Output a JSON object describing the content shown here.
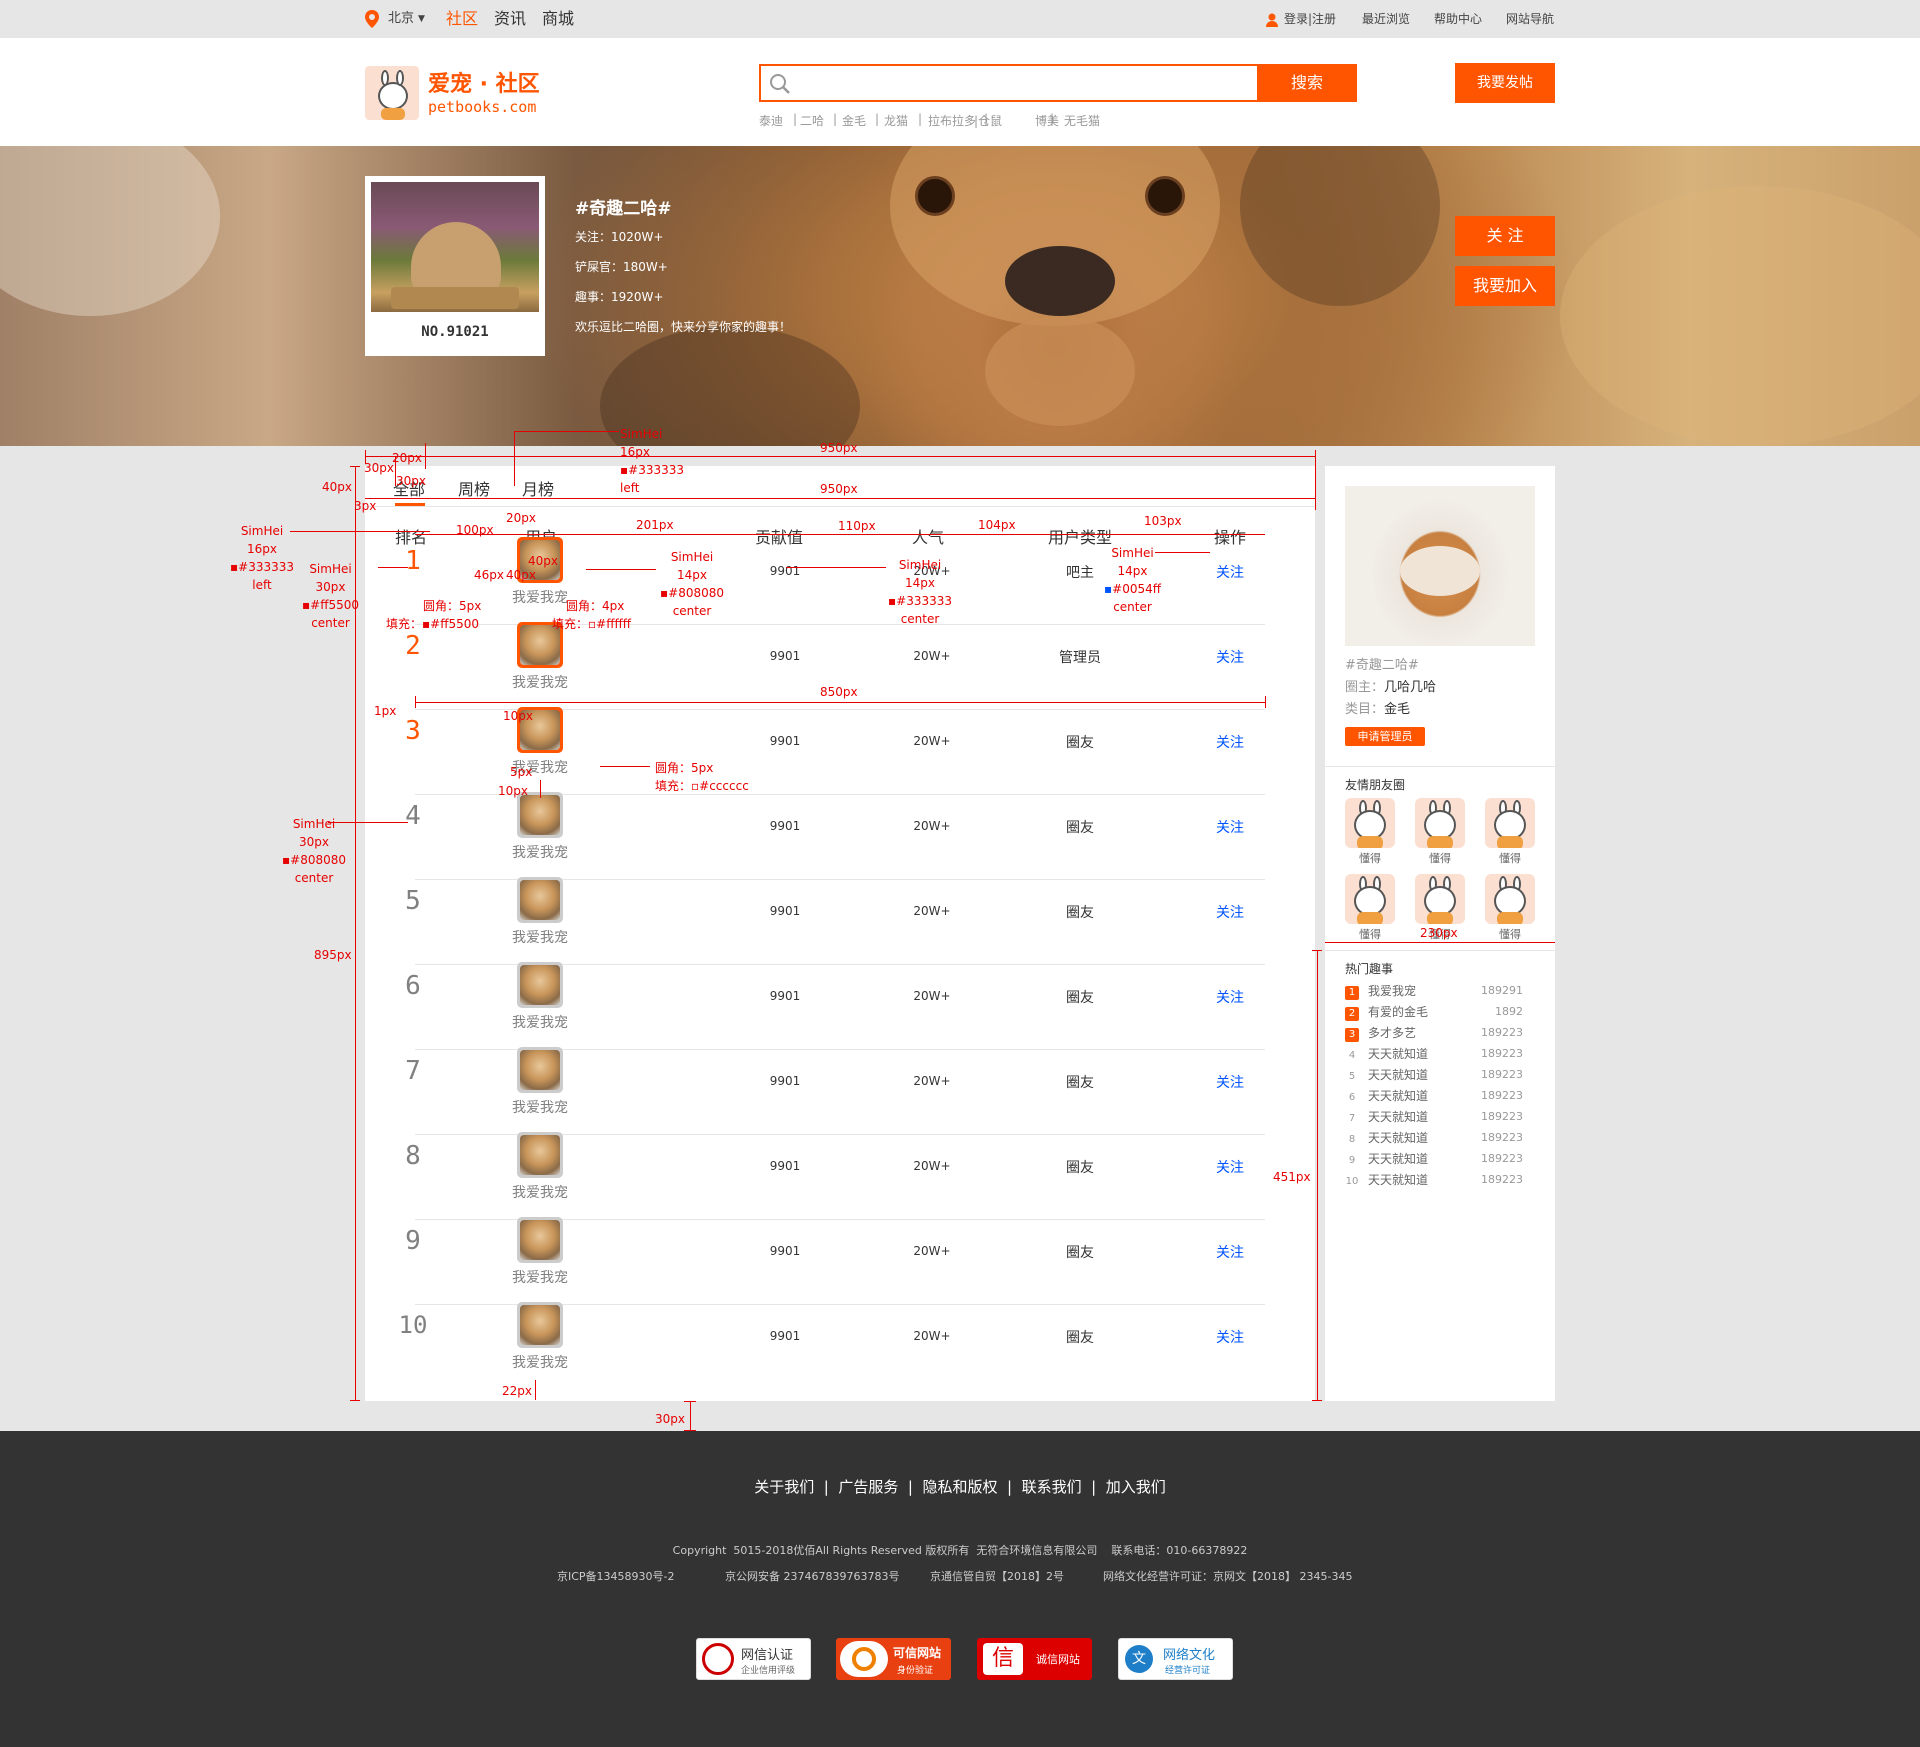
{
  "topbar": {
    "city": "北京",
    "nav": [
      "社区",
      "资讯",
      "商城"
    ],
    "login": "登录|注册",
    "right": [
      "最近浏览",
      "帮助中心",
      "网站导航"
    ]
  },
  "logo": {
    "title": "爱宠 · 社区",
    "domain": "petbooks.com"
  },
  "search": {
    "button": "搜索",
    "tags": [
      "泰迪",
      "|",
      "二哈",
      "|",
      "金毛",
      "|",
      "龙猫",
      "|",
      "拉布拉多",
      "|仓鼠",
      "|",
      "博美",
      "|",
      "无毛猫"
    ]
  },
  "post_button": "我要发帖",
  "banner": {
    "card_no": "NO.91021",
    "title": "#奇趣二哈#",
    "follow": "关注：1020W+",
    "officers": "铲屎官：180W+",
    "fun": "趣事：1920W+",
    "desc": "欢乐逗比二哈圈，快来分享你家的趣事！",
    "follow_btn": "关 注",
    "join_btn": "我要加入"
  },
  "tabs": [
    "全部",
    "周榜",
    "月榜"
  ],
  "table": {
    "headers": [
      "排名",
      "用户",
      "贡献值",
      "人气",
      "用户类型",
      "操作"
    ],
    "rows": [
      {
        "rank": "1",
        "user": "我爱我宠",
        "contrib": "9901",
        "pop": "20W+",
        "type": "吧主",
        "op": "关注"
      },
      {
        "rank": "2",
        "user": "我爱我宠",
        "contrib": "9901",
        "pop": "20W+",
        "type": "管理员",
        "op": "关注"
      },
      {
        "rank": "3",
        "user": "我爱我宠",
        "contrib": "9901",
        "pop": "20W+",
        "type": "圈友",
        "op": "关注"
      },
      {
        "rank": "4",
        "user": "我爱我宠",
        "contrib": "9901",
        "pop": "20W+",
        "type": "圈友",
        "op": "关注"
      },
      {
        "rank": "5",
        "user": "我爱我宠",
        "contrib": "9901",
        "pop": "20W+",
        "type": "圈友",
        "op": "关注"
      },
      {
        "rank": "6",
        "user": "我爱我宠",
        "contrib": "9901",
        "pop": "20W+",
        "type": "圈友",
        "op": "关注"
      },
      {
        "rank": "7",
        "user": "我爱我宠",
        "contrib": "9901",
        "pop": "20W+",
        "type": "圈友",
        "op": "关注"
      },
      {
        "rank": "8",
        "user": "我爱我宠",
        "contrib": "9901",
        "pop": "20W+",
        "type": "圈友",
        "op": "关注"
      },
      {
        "rank": "9",
        "user": "我爱我宠",
        "contrib": "9901",
        "pop": "20W+",
        "type": "圈友",
        "op": "关注"
      },
      {
        "rank": "10",
        "user": "我爱我宠",
        "contrib": "9901",
        "pop": "20W+",
        "type": "圈友",
        "op": "关注"
      }
    ]
  },
  "sidebar": {
    "circle": "#奇趣二哈#",
    "owner_label": "圈主：",
    "owner": "几哈几哈",
    "cat_label": "类目：",
    "cat": "金毛",
    "apply": "申请管理员",
    "friends_title": "友情朋友圈",
    "friends": [
      "懂得",
      "懂得",
      "懂得",
      "懂得",
      "懂得",
      "懂得"
    ],
    "hot_title": "热门趣事",
    "hot": [
      {
        "n": "1",
        "t": "我爱我宠",
        "c": "189291"
      },
      {
        "n": "2",
        "t": "有爱的金毛",
        "c": "1892"
      },
      {
        "n": "3",
        "t": "多才多艺",
        "c": "189223"
      },
      {
        "n": "4",
        "t": "天天就知道",
        "c": "189223"
      },
      {
        "n": "5",
        "t": "天天就知道",
        "c": "189223"
      },
      {
        "n": "6",
        "t": "天天就知道",
        "c": "189223"
      },
      {
        "n": "7",
        "t": "天天就知道",
        "c": "189223"
      },
      {
        "n": "8",
        "t": "天天就知道",
        "c": "189223"
      },
      {
        "n": "9",
        "t": "天天就知道",
        "c": "189223"
      },
      {
        "n": "10",
        "t": "天天就知道",
        "c": "189223"
      }
    ]
  },
  "annotations": {
    "a950a": "950px",
    "a950b": "950px",
    "a20": "20px",
    "a30": "30px",
    "a30b": "30px",
    "a40": "40px",
    "a3": "3px",
    "a20b": "20px",
    "a100": "100px",
    "a201": "201px",
    "a110": "110px",
    "a104": "104px",
    "a103": "103px",
    "font1": "SimHei",
    "font1s": "16px",
    "font1c": "#333333",
    "font1a": "left",
    "font2": "SimHei",
    "font2s": "16px",
    "font2c": "#333333",
    "font2a": "left",
    "font3": "SimHei",
    "font3s": "30px",
    "font3c": "#ff5500",
    "font3a": "center",
    "font4": "SimHei",
    "font4s": "14px",
    "font4c": "#808080",
    "font4a": "center",
    "font5": "SimHei",
    "font5s": "14px",
    "font5c": "#333333",
    "font5a": "center",
    "font6": "SimHei",
    "font6s": "14px",
    "font6c": "#0054ff",
    "font6a": "center",
    "font7": "SimHei",
    "font7s": "30px",
    "font7c": "#808080",
    "font7a": "center",
    "a46": "46px",
    "a40b": "40px",
    "a40c": "40px",
    "r5": "圆角：5px",
    "f1": "填充：",
    "f1c": "#ff5500",
    "r4": "圆角：4px",
    "f2": "填充：",
    "f2c": "#ffffff",
    "a850": "850px",
    "a1": "1px",
    "a10": "10px",
    "a5": "5px",
    "a10b": "10px",
    "r5b": "圆角：5px",
    "f3": "填充：",
    "f3c": "#cccccc",
    "a895": "895px",
    "a451": "451px",
    "a22": "22px",
    "a30c": "30px",
    "a230": "230px"
  },
  "footer": {
    "links": "关于我们  |  广告服务  |  隐私和版权  |  联系我们  |  加入我们",
    "copy": "Copyright  5015-2018优佰All Rights Reserved 版权所有  无符合环境信息有限公司    联系电话：010-66378922",
    "icp": [
      "京ICP备13458930号-2",
      "京公网安备 237467839763783号",
      "京通信管自贸【2018】2号",
      "网络文化经营许可证：京网文【2018】 2345-345"
    ],
    "badges": [
      "网信认证",
      "可信网站",
      "诚信网站",
      "网络文化"
    ],
    "badge_subs": [
      "企业信用评级",
      "身份验证",
      "",
      "经营许可证"
    ]
  },
  "colors": {
    "accent": "#ff5500",
    "link": "#0054ff",
    "annotation": "#e60000",
    "footer": "#333333"
  }
}
